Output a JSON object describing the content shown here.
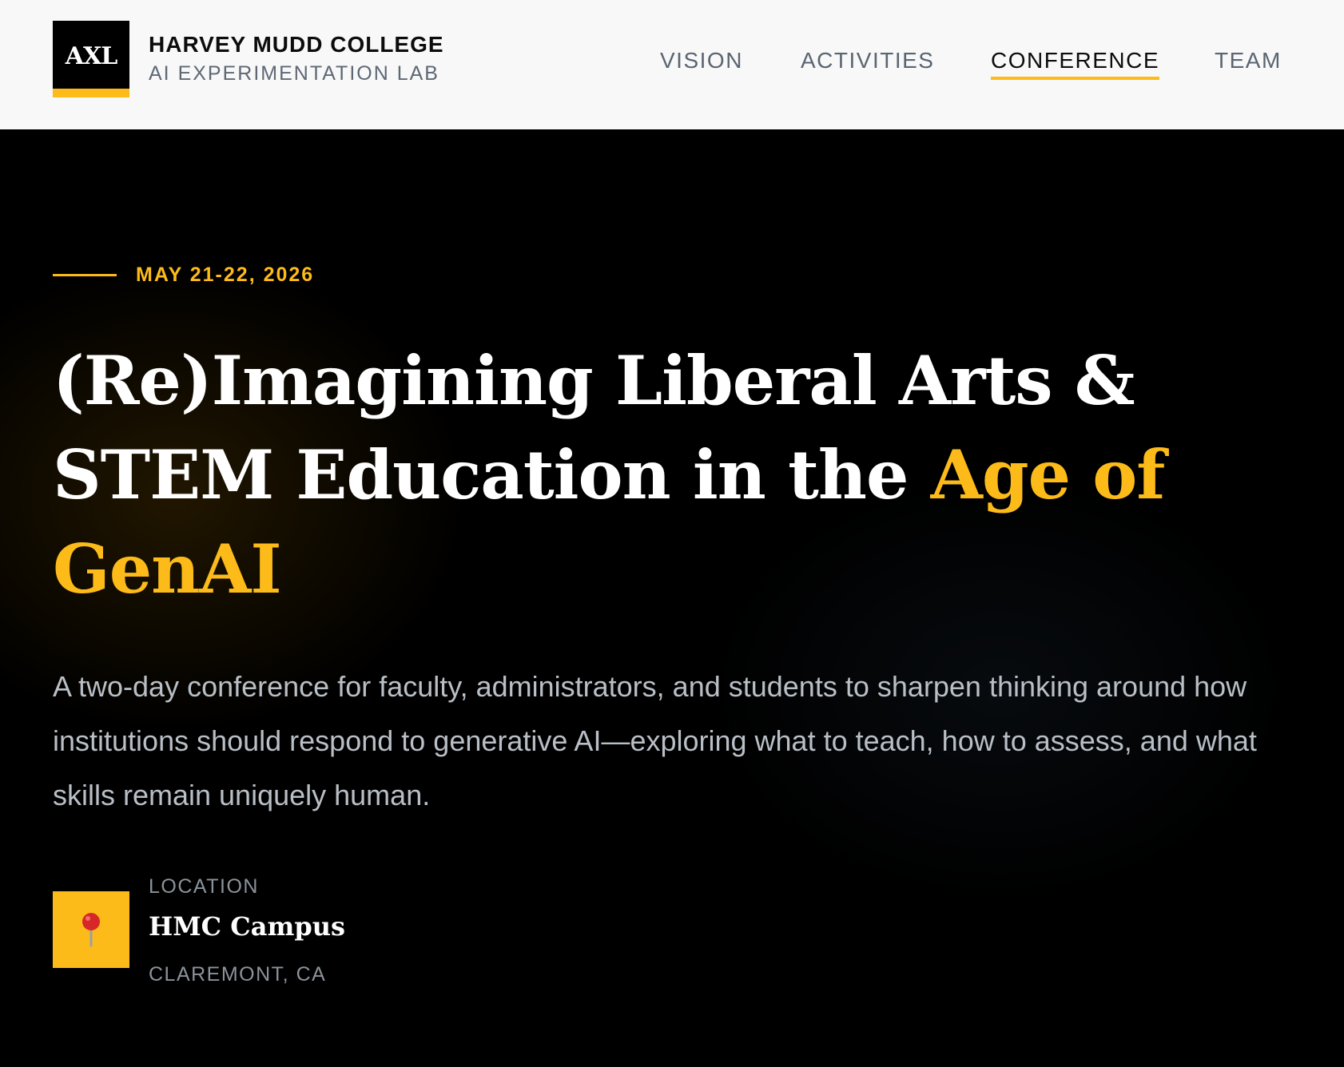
{
  "header": {
    "logo_text": "AXL",
    "brand_title": "HARVEY MUDD COLLEGE",
    "brand_subtitle": "AI EXPERIMENTATION LAB",
    "nav": {
      "vision": "VISION",
      "activities": "ACTIVITIES",
      "conference": "CONFERENCE",
      "team": "TEAM",
      "active": "CONFERENCE"
    }
  },
  "hero": {
    "date": "MAY 21-22, 2026",
    "title_part1": "(Re)Imagining Liberal Arts & STEM Education in the ",
    "title_accent": "Age of GenAI",
    "description": "A two-day conference for faculty, administrators, and students to sharpen thinking around how institutions should respond to generative AI—exploring what to teach, how to assess, and what skills remain uniquely human.",
    "location": {
      "label": "LOCATION",
      "icon": "map-pin-icon",
      "name": "HMC Campus",
      "city": "CLAREMONT, CA"
    }
  },
  "colors": {
    "accent": "#fdbb1a",
    "background": "#000000",
    "header_bg": "#f8f8f8"
  }
}
